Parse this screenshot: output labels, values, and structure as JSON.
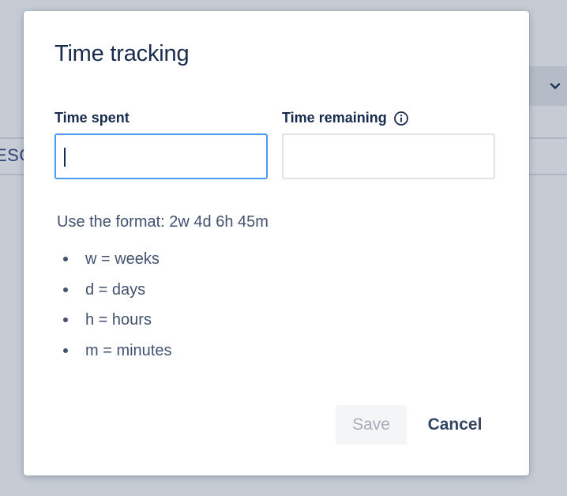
{
  "background": {
    "tab_partial_text": "ESC"
  },
  "modal": {
    "title": "Time tracking",
    "fields": {
      "time_spent": {
        "label": "Time spent",
        "value": "",
        "focused": true
      },
      "time_remaining": {
        "label": "Time remaining",
        "value": "",
        "icon": "info-icon"
      }
    },
    "help": {
      "format_text": "Use the format: 2w 4d 6h 45m",
      "units": [
        {
          "label": "w = weeks"
        },
        {
          "label": "d = days"
        },
        {
          "label": "h = hours"
        },
        {
          "label": "m = minutes"
        }
      ]
    },
    "actions": {
      "save_label": "Save",
      "save_disabled": true,
      "cancel_label": "Cancel"
    }
  },
  "colors": {
    "title_text": "#172b4d",
    "body_text": "#42526e",
    "focus_border": "#4c9aff",
    "input_border": "#dfe1e6",
    "disabled_text": "#a5adba",
    "disabled_bg": "#f4f5f7"
  }
}
